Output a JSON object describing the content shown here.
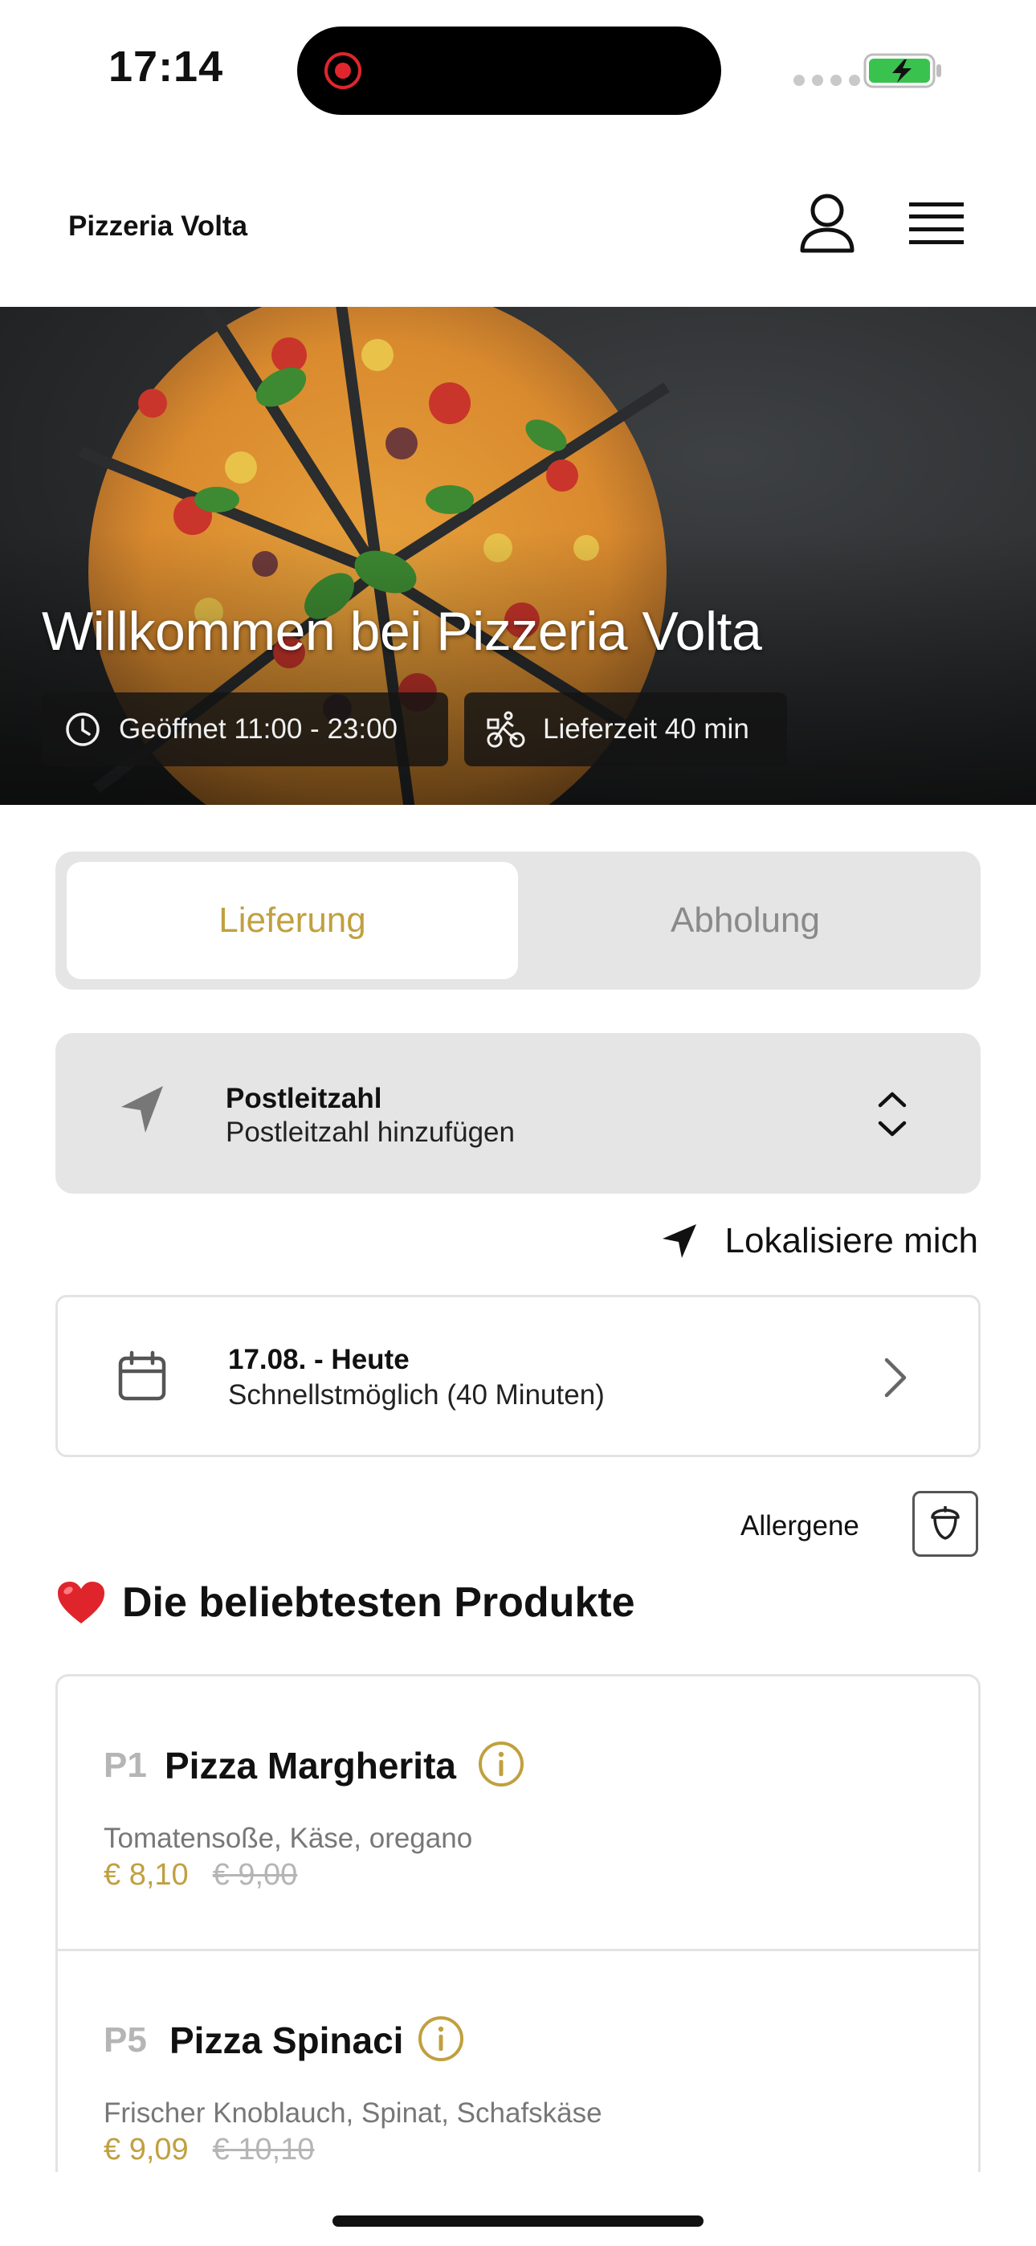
{
  "status_bar": {
    "time": "17:14"
  },
  "header": {
    "brand": "Pizzeria Volta",
    "user_icon": "user-icon",
    "menu_icon": "hamburger-menu-icon"
  },
  "hero": {
    "title": "Willkommen bei Pizzeria Volta",
    "opening_hours": "Geöffnet 11:00 - 23:00",
    "delivery_time": "Lieferzeit 40 min"
  },
  "mode_toggle": {
    "delivery": "Lieferung",
    "pickup": "Abholung",
    "selected": "Lieferung"
  },
  "postal_code": {
    "label": "Postleitzahl",
    "value": "Postleitzahl hinzufügen"
  },
  "locate": {
    "label": "Lokalisiere mich"
  },
  "date": {
    "label": "17.08. - Heute",
    "value": "Schnellstmöglich (40 Minuten)"
  },
  "allergens": {
    "label": "Allergene"
  },
  "section": {
    "title": "Die beliebtesten Produkte"
  },
  "products": [
    {
      "code": "P1",
      "name": "Pizza Margherita",
      "description": "Tomatensoße, Käse, oregano",
      "price": "€ 8,10",
      "old_price": "€ 9,00"
    },
    {
      "code": "P5",
      "name": "Pizza Spinaci",
      "description": "Frischer Knoblauch, Spinat, Schafskäse",
      "price": "€ 9,09",
      "old_price": "€ 10,10"
    }
  ],
  "colors": {
    "accent": "#c0a040",
    "panel": "#e5e5e5",
    "text": "#111111",
    "muted": "#8a8a8a"
  }
}
